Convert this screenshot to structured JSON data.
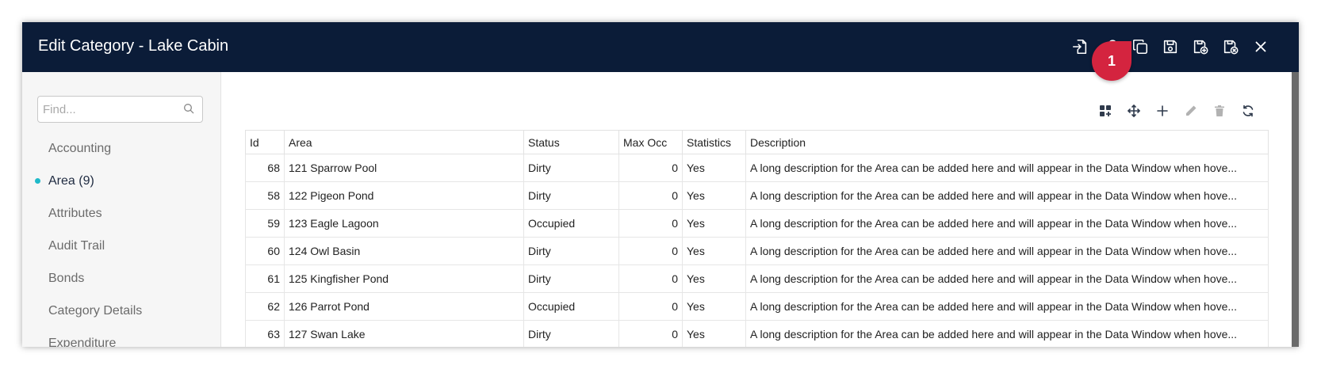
{
  "window": {
    "title": "Edit Category - Lake Cabin",
    "actions": [
      {
        "name": "import-icon"
      },
      {
        "name": "key-icon"
      },
      {
        "name": "copy-icon"
      },
      {
        "name": "save-icon"
      },
      {
        "name": "save-add-icon"
      },
      {
        "name": "save-close-icon"
      },
      {
        "name": "close-icon"
      }
    ]
  },
  "callout": {
    "label": "1",
    "color": "#d4243f"
  },
  "sidebar": {
    "search_placeholder": "Find...",
    "items": [
      {
        "label": "Accounting"
      },
      {
        "label": "Area (9)"
      },
      {
        "label": "Attributes"
      },
      {
        "label": "Audit Trail"
      },
      {
        "label": "Bonds"
      },
      {
        "label": "Category Details"
      },
      {
        "label": "Expenditure"
      }
    ],
    "active_index": 1
  },
  "grid": {
    "tools": [
      "select-columns-icon",
      "move-icon",
      "add-icon",
      "edit-icon",
      "delete-icon",
      "refresh-icon"
    ],
    "columns": [
      "Id",
      "Area",
      "Status",
      "Max Occ",
      "Statistics",
      "Description"
    ],
    "rows": [
      [
        "68",
        "121 Sparrow Pool",
        "Dirty",
        "0",
        "Yes",
        "A long description for the Area can be added here and will appear in the Data Window when hove..."
      ],
      [
        "58",
        "122 Pigeon Pond",
        "Dirty",
        "0",
        "Yes",
        "A long description for the Area can be added here and will appear in the Data Window when hove..."
      ],
      [
        "59",
        "123 Eagle Lagoon",
        "Occupied",
        "0",
        "Yes",
        "A long description for the Area can be added here and will appear in the Data Window when hove..."
      ],
      [
        "60",
        "124 Owl Basin",
        "Dirty",
        "0",
        "Yes",
        "A long description for the Area can be added here and will appear in the Data Window when hove..."
      ],
      [
        "61",
        "125 Kingfisher Pond",
        "Dirty",
        "0",
        "Yes",
        "A long description for the Area can be added here and will appear in the Data Window when hove..."
      ],
      [
        "62",
        "126 Parrot Pond",
        "Occupied",
        "0",
        "Yes",
        "A long description for the Area can be added here and will appear in the Data Window when hove..."
      ],
      [
        "63",
        "127 Swan Lake",
        "Dirty",
        "0",
        "Yes",
        "A long description for the Area can be added here and will appear in the Data Window when hove..."
      ]
    ]
  },
  "colors": {
    "titlebar": "#0b1c38",
    "accent_dot": "#1fb9c9",
    "callout": "#d4243f"
  }
}
